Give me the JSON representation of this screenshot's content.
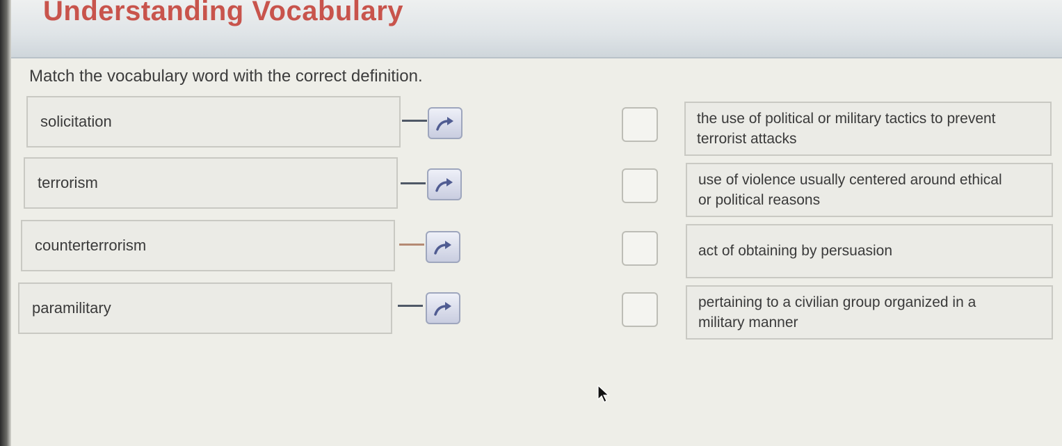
{
  "header": {
    "title": "Understanding Vocabulary"
  },
  "instructions": "Match the vocabulary word with the correct definition.",
  "terms": [
    {
      "label": "solicitation"
    },
    {
      "label": "terrorism"
    },
    {
      "label": "counterterrorism"
    },
    {
      "label": "paramilitary"
    }
  ],
  "definitions": [
    {
      "text": "the use of political or military tactics to prevent terrorist attacks"
    },
    {
      "text": "use of violence usually centered around ethical or political reasons"
    },
    {
      "text": "act of obtaining by persuasion"
    },
    {
      "text": "pertaining to a civilian group organized in a military manner"
    }
  ],
  "icons": {
    "arrow_button": "curved-arrow-right-icon",
    "cursor": "mouse-pointer-icon"
  },
  "colors": {
    "title": "#c8544c",
    "arrow": "#505c92"
  }
}
